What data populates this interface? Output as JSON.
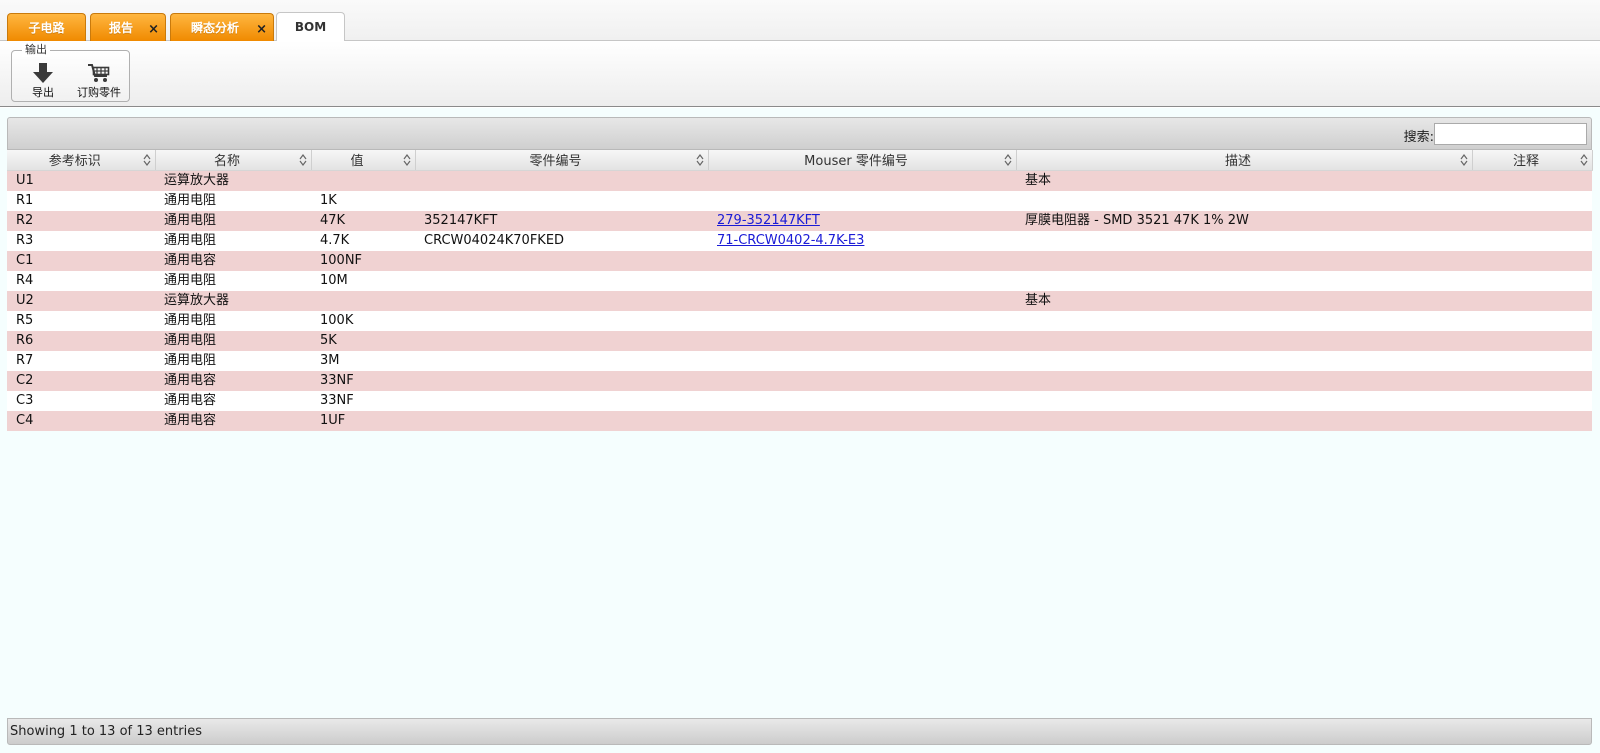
{
  "tabs": [
    {
      "label": "子电路",
      "closable": false,
      "active": false
    },
    {
      "label": "报告",
      "closable": true,
      "active": false
    },
    {
      "label": "瞬态分析",
      "closable": true,
      "active": false
    },
    {
      "label": "BOM",
      "closable": false,
      "active": true
    }
  ],
  "tab_close_glyph": "×",
  "toolbar": {
    "group_label": "输出",
    "export_label": "导出",
    "order_label": "订购零件"
  },
  "search": {
    "label": "搜索:",
    "value": ""
  },
  "table": {
    "columns": [
      "参考标识",
      "名称",
      "值",
      "零件编号",
      "Mouser 零件编号",
      "描述",
      "注释"
    ],
    "rows": [
      {
        "ref": "U1",
        "name": "运算放大器",
        "value": "",
        "part": "",
        "mouser": "",
        "desc": "基本",
        "note": ""
      },
      {
        "ref": "R1",
        "name": "通用电阻",
        "value": "1K",
        "part": "",
        "mouser": "",
        "desc": "",
        "note": ""
      },
      {
        "ref": "R2",
        "name": "通用电阻",
        "value": "47K",
        "part": "352147KFT",
        "mouser": "279-352147KFT",
        "desc": "厚膜电阻器 - SMD 3521 47K 1% 2W",
        "note": ""
      },
      {
        "ref": "R3",
        "name": "通用电阻",
        "value": "4.7K",
        "part": "CRCW04024K70FKED",
        "mouser": "71-CRCW0402-4.7K-E3",
        "desc": "",
        "note": ""
      },
      {
        "ref": "C1",
        "name": "通用电容",
        "value": "100NF",
        "part": "",
        "mouser": "",
        "desc": "",
        "note": ""
      },
      {
        "ref": "R4",
        "name": "通用电阻",
        "value": "10M",
        "part": "",
        "mouser": "",
        "desc": "",
        "note": ""
      },
      {
        "ref": "U2",
        "name": "运算放大器",
        "value": "",
        "part": "",
        "mouser": "",
        "desc": "基本",
        "note": ""
      },
      {
        "ref": "R5",
        "name": "通用电阻",
        "value": "100K",
        "part": "",
        "mouser": "",
        "desc": "",
        "note": ""
      },
      {
        "ref": "R6",
        "name": "通用电阻",
        "value": "5K",
        "part": "",
        "mouser": "",
        "desc": "",
        "note": ""
      },
      {
        "ref": "R7",
        "name": "通用电阻",
        "value": "3M",
        "part": "",
        "mouser": "",
        "desc": "",
        "note": ""
      },
      {
        "ref": "C2",
        "name": "通用电容",
        "value": "33NF",
        "part": "",
        "mouser": "",
        "desc": "",
        "note": ""
      },
      {
        "ref": "C3",
        "name": "通用电容",
        "value": "33NF",
        "part": "",
        "mouser": "",
        "desc": "",
        "note": ""
      },
      {
        "ref": "C4",
        "name": "通用电容",
        "value": "1UF",
        "part": "",
        "mouser": "",
        "desc": "",
        "note": ""
      }
    ]
  },
  "footer": {
    "info": "Showing 1 to 13 of 13 entries"
  },
  "colors": {
    "tab_orange": "#f39a1a",
    "row_odd": "#f0d2d2",
    "row_even": "#ffffff",
    "link": "#1a1ad6",
    "content_bg": "#f5fefe"
  },
  "icons": {
    "export": "download-arrow-icon",
    "order": "shopping-cart-icon",
    "sort": "sort-both-icon"
  }
}
